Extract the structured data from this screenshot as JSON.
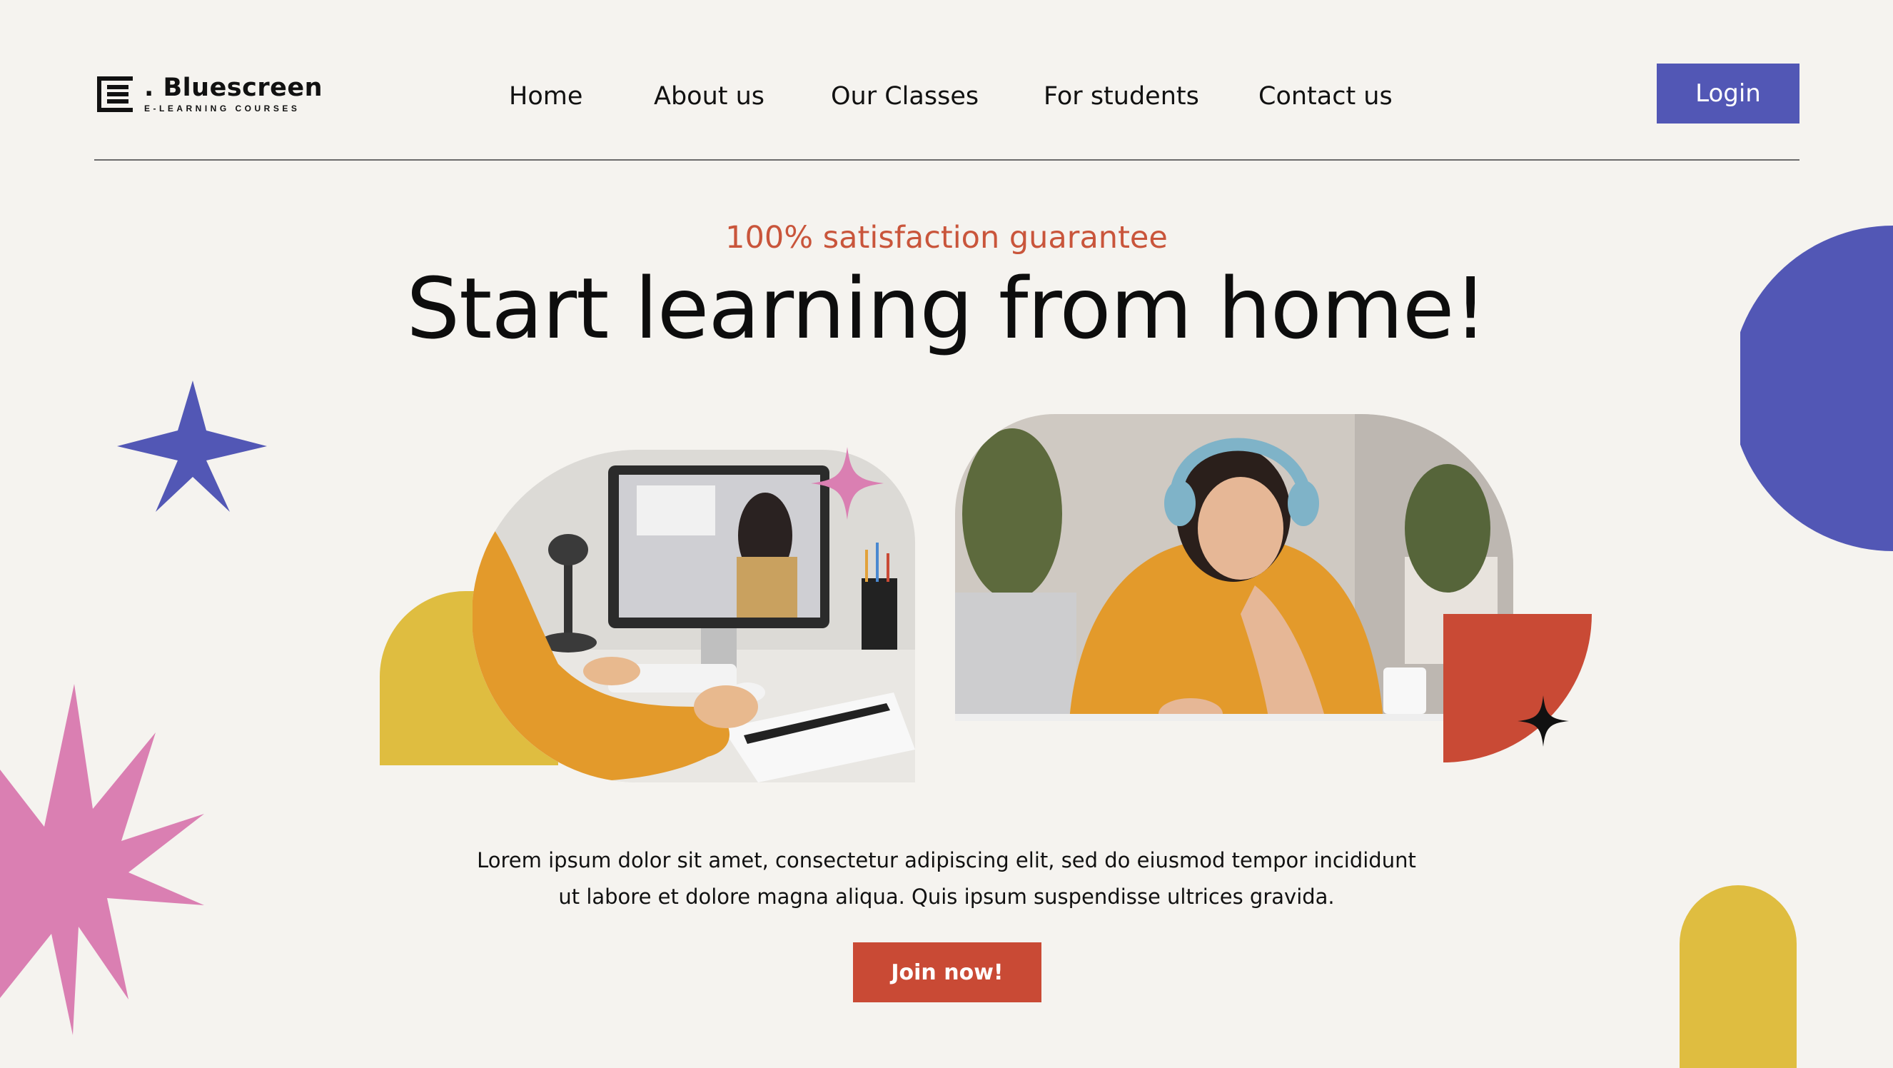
{
  "brand": {
    "name": ". Bluescreen",
    "tagline": "E-LEARNING COURSES"
  },
  "nav": {
    "items": [
      {
        "label": "Home"
      },
      {
        "label": "About us"
      },
      {
        "label": "Our Classes"
      },
      {
        "label": "For students"
      },
      {
        "label": "Contact us"
      }
    ],
    "login_label": "Login"
  },
  "hero": {
    "eyebrow": "100% satisfaction guarantee",
    "title": "Start learning from home!",
    "body_line1": "Lorem ipsum dolor sit amet, consectetur adipiscing elit, sed do eiusmod tempor incididunt",
    "body_line2": "ut labore et dolore magna aliqua. Quis ipsum suspendisse ultrices gravida.",
    "cta_label": "Join now!"
  },
  "images": {
    "left": "student-at-computer-photo",
    "right": "student-with-headphones-photo"
  },
  "colors": {
    "background": "#f5f3ef",
    "blue": "#5257b5",
    "red": "#c94a35",
    "yellow": "#dfbd40",
    "pink": "#da7fb2",
    "orange": "#e39a2b"
  }
}
